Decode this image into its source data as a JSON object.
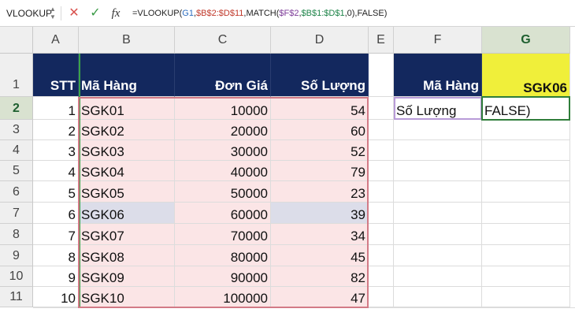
{
  "name_box": "VLOOKUP",
  "formula_bar": {
    "cancel_icon": "x-icon",
    "enter_icon": "check-icon",
    "fx_label": "fx",
    "parts": [
      {
        "text": "=VLOOKUP(",
        "color": "black"
      },
      {
        "text": "G1",
        "color": "blue"
      },
      {
        "text": ",",
        "color": "black"
      },
      {
        "text": "$B$2:$D$11",
        "color": "red"
      },
      {
        "text": ",MATCH(",
        "color": "black"
      },
      {
        "text": "$F$2",
        "color": "purple"
      },
      {
        "text": ",",
        "color": "black"
      },
      {
        "text": "$B$1:$D$1",
        "color": "green"
      },
      {
        "text": ",0),FALSE)",
        "color": "black"
      }
    ]
  },
  "columns": [
    "A",
    "B",
    "C",
    "D",
    "E",
    "F",
    "G"
  ],
  "rows": [
    "1",
    "2",
    "3",
    "4",
    "5",
    "6",
    "7",
    "8",
    "9",
    "10",
    "11"
  ],
  "active_row": "2",
  "active_column": "G",
  "headers": {
    "stt": "STT",
    "ma_hang": "Mã Hàng",
    "don_gia": "Đơn Giá",
    "so_luong": "Số Lượng"
  },
  "table": [
    {
      "stt": "1",
      "ma": "SGK01",
      "gia": "10000",
      "sl": "54"
    },
    {
      "stt": "2",
      "ma": "SGK02",
      "gia": "20000",
      "sl": "60"
    },
    {
      "stt": "3",
      "ma": "SGK03",
      "gia": "30000",
      "sl": "52"
    },
    {
      "stt": "4",
      "ma": "SGK04",
      "gia": "40000",
      "sl": "79"
    },
    {
      "stt": "5",
      "ma": "SGK05",
      "gia": "50000",
      "sl": "23"
    },
    {
      "stt": "6",
      "ma": "SGK06",
      "gia": "60000",
      "sl": "39"
    },
    {
      "stt": "7",
      "ma": "SGK07",
      "gia": "70000",
      "sl": "34"
    },
    {
      "stt": "8",
      "ma": "SGK08",
      "gia": "80000",
      "sl": "45"
    },
    {
      "stt": "9",
      "ma": "SGK09",
      "gia": "90000",
      "sl": "82"
    },
    {
      "stt": "10",
      "ma": "SGK10",
      "gia": "100000",
      "sl": "47"
    }
  ],
  "lookup": {
    "f1": "Mã Hàng",
    "g1": "SGK06",
    "f2": "Số Lượng",
    "g2": "FALSE)"
  },
  "colors": {
    "header_fill": "#13285e",
    "range_fill": "#fbe5e6",
    "highlight_fill": "#dcdde9",
    "lookup_value_fill": "#f0ef3a",
    "active_header": "#1e5f2f"
  }
}
